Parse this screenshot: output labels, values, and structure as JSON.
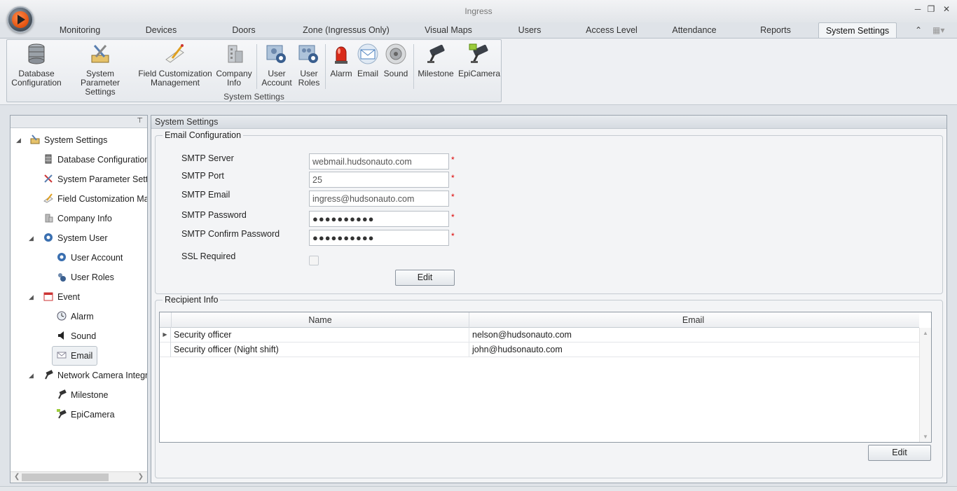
{
  "window": {
    "title": "Ingress"
  },
  "tabs": [
    {
      "label": "Monitoring"
    },
    {
      "label": "Devices"
    },
    {
      "label": "Doors"
    },
    {
      "label": "Zone (Ingressus Only)"
    },
    {
      "label": "Visual Maps"
    },
    {
      "label": "Users"
    },
    {
      "label": "Access Level"
    },
    {
      "label": "Attendance"
    },
    {
      "label": "Reports"
    },
    {
      "label": "System Settings",
      "active": true
    }
  ],
  "ribbon": {
    "group_label": "System Settings",
    "buttons": [
      {
        "line1": "Database",
        "line2": "Configuration",
        "icon": "database-icon"
      },
      {
        "line1": "System Parameter",
        "line2": "Settings",
        "icon": "tools-icon"
      },
      {
        "line1": "Field Customization",
        "line2": "Management",
        "icon": "pencil-icon"
      },
      {
        "line1": "Company",
        "line2": "Info",
        "icon": "building-icon"
      },
      {
        "line1": "User",
        "line2": "Account",
        "icon": "user-account-icon"
      },
      {
        "line1": "User",
        "line2": "Roles",
        "icon": "user-roles-icon"
      },
      {
        "line1": "Alarm",
        "line2": "",
        "icon": "alarm-icon"
      },
      {
        "line1": "Email",
        "line2": "",
        "icon": "email-icon"
      },
      {
        "line1": "Sound",
        "line2": "",
        "icon": "sound-icon"
      },
      {
        "line1": "Milestone",
        "line2": "",
        "icon": "camera-icon"
      },
      {
        "line1": "EpiCamera",
        "line2": "",
        "icon": "epicamera-icon"
      }
    ]
  },
  "tree": [
    {
      "label": "System Settings"
    },
    {
      "label": "Database Configuration"
    },
    {
      "label": "System Parameter Settings"
    },
    {
      "label": "Field Customization Management"
    },
    {
      "label": "Company Info"
    },
    {
      "label": "System User"
    },
    {
      "label": "User Account"
    },
    {
      "label": "User Roles"
    },
    {
      "label": "Event"
    },
    {
      "label": "Alarm"
    },
    {
      "label": "Sound"
    },
    {
      "label": "Email",
      "selected": true
    },
    {
      "label": "Network Camera Integration"
    },
    {
      "label": "Milestone"
    },
    {
      "label": "EpiCamera"
    }
  ],
  "main": {
    "header": "System Settings",
    "email_config": {
      "title": "Email Configuration",
      "fields": [
        {
          "label": "SMTP Server",
          "value": "webmail.hudsonauto.com",
          "required": "*"
        },
        {
          "label": "SMTP Port",
          "value": "25",
          "required": "*"
        },
        {
          "label": "SMTP Email",
          "value": "ingress@hudsonauto.com",
          "required": "*"
        },
        {
          "label": "SMTP Password",
          "value": "●●●●●●●●●●",
          "required": "*"
        },
        {
          "label": "SMTP Confirm Password",
          "value": "●●●●●●●●●●",
          "required": "*"
        }
      ],
      "ssl_label": "SSL Required",
      "ssl_checked": false,
      "edit_label": "Edit"
    },
    "recipient_info": {
      "title": "Recipient Info",
      "columns": [
        "Name",
        "Email"
      ],
      "rows": [
        {
          "name": "Security officer",
          "email": "nelson@hudsonauto.com"
        },
        {
          "name": "Security officer (Night shift)",
          "email": "john@hudsonauto.com"
        }
      ],
      "edit_label": "Edit"
    }
  }
}
